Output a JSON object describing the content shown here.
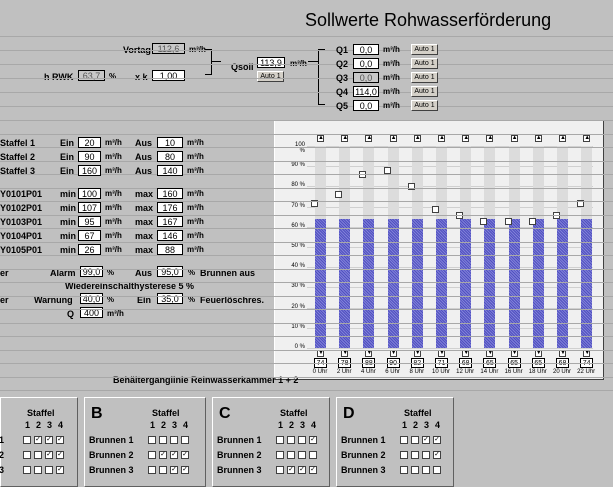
{
  "title": "Sollwerte Rohwasserförderung",
  "top": {
    "vortag_label": "Vortag",
    "vortag_value": "112,6",
    "vortag_unit": "m³/h",
    "hrwk_label": "h RWK",
    "hrwk_value": "63,7",
    "hrwk_unit": "%",
    "xk_label": "x   k",
    "k_value": "1,00",
    "qsoll_label": "Qsoll",
    "qsoll_value": "113,9",
    "qsoll_unit": "m³/h",
    "auto_label": "Auto 1",
    "q": [
      {
        "label": "Q1",
        "value": "0,0",
        "unit": "m³/h",
        "btn": "Auto 1"
      },
      {
        "label": "Q2",
        "value": "0,0",
        "unit": "m³/h",
        "btn": "Auto 1"
      },
      {
        "label": "Q3",
        "value": "0,0",
        "unit": "m³/h",
        "btn": "Auto 1"
      },
      {
        "label": "Q4",
        "value": "114,0",
        "unit": "m³/h",
        "btn": "Auto 1"
      },
      {
        "label": "Q5",
        "value": "0,0",
        "unit": "m³/h",
        "btn": "Auto 1"
      }
    ]
  },
  "staffel": [
    {
      "label": "Staffel 1",
      "ein": "20",
      "aus": "10"
    },
    {
      "label": "Staffel 2",
      "ein": "90",
      "aus": "80"
    },
    {
      "label": "Staffel 3",
      "ein": "160",
      "aus": "140"
    }
  ],
  "staffel_labels": {
    "ein": "Ein",
    "aus": "Aus",
    "unit": "m³/h"
  },
  "pumps": [
    {
      "label": "Y0101P01",
      "min": "100",
      "max": "160"
    },
    {
      "label": "Y0102P01",
      "min": "107",
      "max": "176"
    },
    {
      "label": "Y0103P01",
      "min": "95",
      "max": "167"
    },
    {
      "label": "Y0104P01",
      "min": "67",
      "max": "146"
    },
    {
      "label": "Y0105P01",
      "min": "26",
      "max": "88"
    }
  ],
  "pump_labels": {
    "min": "min",
    "max": "max",
    "unit": "m³/h"
  },
  "alarm": {
    "prefix1": "er",
    "alarm_label": "Alarm",
    "alarm_value": "99,0",
    "alarm_unit": "%",
    "aus_label": "Aus",
    "aus_value": "95,0",
    "aus_unit": "%",
    "aus_text": "Brunnen aus",
    "hyst_text": "Wiedereinschalthysterese 5 %",
    "prefix2": "er",
    "warn_label": "Warnung",
    "warn_value": "40,0",
    "warn_unit": "%",
    "ein_label": "Ein",
    "ein_value": "35,0",
    "ein_unit": "%",
    "ein_text": "Feuerlöschres.",
    "q_label": "Q",
    "q_value": "400",
    "q_unit": "m³/h"
  },
  "chart_caption": "Behälterganglinie Reinwasserkammer 1 + 2",
  "chart_data": {
    "type": "bar",
    "yticks": [
      "100 %",
      "90 %",
      "80 %",
      "70 %",
      "60 %",
      "50 %",
      "40 %",
      "30 %",
      "20 %",
      "10 %",
      "0 %"
    ],
    "categories": [
      "0 Uhr",
      "2 Uhr",
      "4 Uhr",
      "6 Uhr",
      "8 Uhr",
      "10 Uhr",
      "12 Uhr",
      "14 Uhr",
      "16 Uhr",
      "18 Uhr",
      "20 Uhr",
      "22 Uhr"
    ],
    "setpoints": [
      "74",
      "78",
      "88",
      "90",
      "82",
      "71",
      "68",
      "65",
      "65",
      "65",
      "68",
      "74"
    ],
    "values": [
      64,
      64,
      64,
      64,
      64,
      64,
      64,
      64,
      64,
      64,
      64,
      64
    ],
    "markers": [
      72,
      76,
      86,
      88,
      80,
      69,
      66,
      63,
      63,
      63,
      66,
      72
    ],
    "ylim": [
      0,
      100
    ]
  },
  "panels": [
    {
      "letter": "",
      "staffel": "Staffel",
      "cols": [
        "1",
        "2",
        "3",
        "4"
      ],
      "rows": [
        {
          "label": "1",
          "checks": [
            false,
            true,
            true,
            true
          ]
        },
        {
          "label": "2",
          "checks": [
            false,
            false,
            true,
            true
          ]
        },
        {
          "label": "3",
          "checks": [
            false,
            false,
            false,
            true
          ]
        }
      ]
    },
    {
      "letter": "B",
      "staffel": "Staffel",
      "cols": [
        "1",
        "2",
        "3",
        "4"
      ],
      "rows": [
        {
          "label": "Brunnen 1",
          "checks": [
            false,
            false,
            false,
            false
          ]
        },
        {
          "label": "Brunnen 2",
          "checks": [
            false,
            true,
            true,
            true
          ]
        },
        {
          "label": "Brunnen 3",
          "checks": [
            false,
            false,
            true,
            true
          ]
        }
      ]
    },
    {
      "letter": "C",
      "staffel": "Staffel",
      "cols": [
        "1",
        "2",
        "3",
        "4"
      ],
      "rows": [
        {
          "label": "Brunnen 1",
          "checks": [
            false,
            false,
            false,
            true
          ]
        },
        {
          "label": "Brunnen 2",
          "checks": [
            false,
            false,
            false,
            false
          ]
        },
        {
          "label": "Brunnen 3",
          "checks": [
            false,
            true,
            true,
            true
          ]
        }
      ]
    },
    {
      "letter": "D",
      "staffel": "Staffel",
      "cols": [
        "1",
        "2",
        "3",
        "4"
      ],
      "rows": [
        {
          "label": "Brunnen 1",
          "checks": [
            false,
            false,
            true,
            true
          ]
        },
        {
          "label": "Brunnen 2",
          "checks": [
            false,
            false,
            false,
            true
          ]
        },
        {
          "label": "Brunnen 3",
          "checks": [
            false,
            false,
            false,
            false
          ]
        }
      ]
    }
  ]
}
